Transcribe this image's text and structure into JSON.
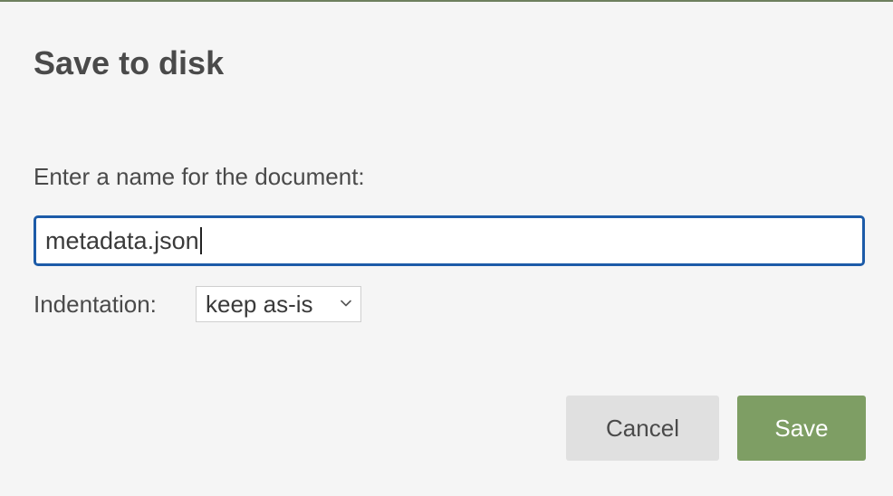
{
  "dialog": {
    "title": "Save to disk",
    "prompt": "Enter a name for the document:",
    "filename": {
      "value": "metadata.json"
    },
    "indentation": {
      "label": "Indentation:",
      "selected": "keep as-is"
    },
    "buttons": {
      "cancel_label": "Cancel",
      "save_label": "Save"
    }
  },
  "colors": {
    "background": "#f5f5f5",
    "input_focus_border": "#1c5ba8",
    "save_button": "#7e9e64",
    "cancel_button": "#e0e0e0",
    "text": "#4a4a4a"
  },
  "icons": {
    "select_chevron": "chevron-down-icon"
  }
}
